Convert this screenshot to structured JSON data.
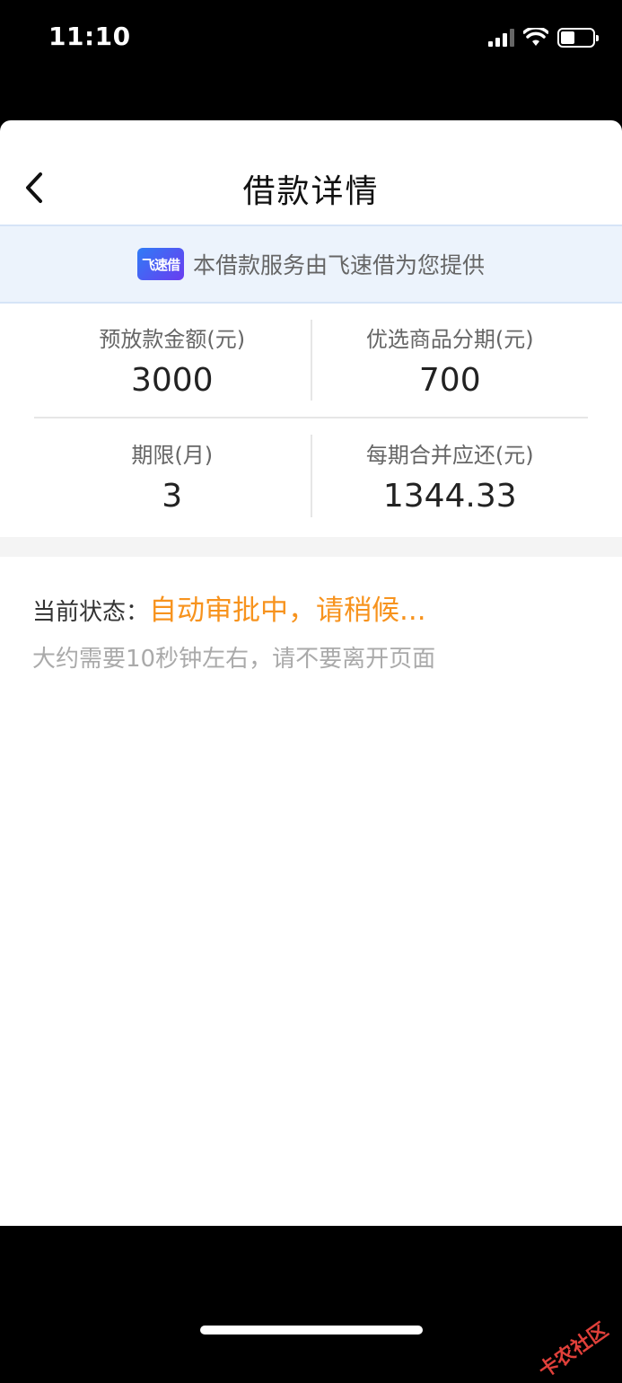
{
  "status_bar": {
    "time": "11:10"
  },
  "nav": {
    "title": "借款详情",
    "back_icon": "chevron-left-icon"
  },
  "provider": {
    "logo_text": "飞速借",
    "text": "本借款服务由飞速借为您提供"
  },
  "details": [
    {
      "label": "预放款金额(元)",
      "value": "3000"
    },
    {
      "label": "优选商品分期(元)",
      "value": "700"
    },
    {
      "label": "期限(月)",
      "value": "3"
    },
    {
      "label": "每期合并应还(元)",
      "value": "1344.33"
    }
  ],
  "status": {
    "label": "当前状态：",
    "value": "自动审批中，请稍候...",
    "hint": "大约需要10秒钟左右，请不要离开页面"
  },
  "watermark": "卡农社区",
  "colors": {
    "accent_orange": "#f7931e",
    "banner_bg": "#ecf3fc"
  }
}
